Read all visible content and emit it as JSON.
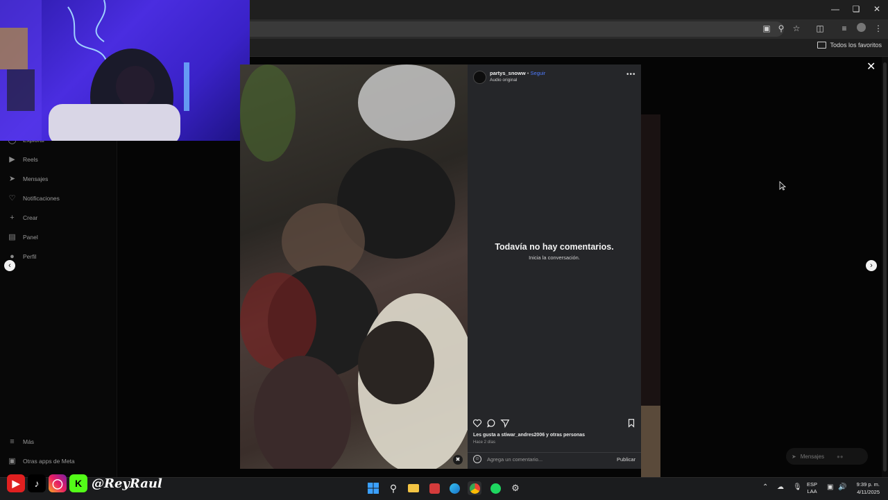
{
  "browser": {
    "bookmarks_folder": "Todos los favoritos"
  },
  "sidebar": {
    "items": [
      {
        "label": "Explorar",
        "icon": "compass-icon"
      },
      {
        "label": "Reels",
        "icon": "reels-icon"
      },
      {
        "label": "Mensajes",
        "icon": "messenger-icon"
      },
      {
        "label": "Notificaciones",
        "icon": "heart-icon"
      },
      {
        "label": "Crear",
        "icon": "plus-icon"
      },
      {
        "label": "Panel",
        "icon": "dashboard-icon"
      },
      {
        "label": "Perfil",
        "icon": "avatar-icon"
      }
    ],
    "bottom": [
      {
        "label": "Más",
        "icon": "menu-icon"
      },
      {
        "label": "Otras apps de Meta",
        "icon": "meta-apps-icon"
      }
    ]
  },
  "post": {
    "username": "partys_snoww",
    "separator": "•",
    "follow_label": "Seguir",
    "audio": "Audio original",
    "empty_title": "Todavía no hay comentarios.",
    "empty_subtitle": "Inicia la conversación.",
    "likes_text": "Les gusta a stiwar_andres2006 y otras personas",
    "time_ago": "Hace 2 días",
    "comment_placeholder": "Agrega un comentario...",
    "publish_label": "Publicar"
  },
  "messages_pill": {
    "label": "Mensajes"
  },
  "overlay": {
    "handle": "@ReyRaul",
    "k_logo": "K"
  },
  "taskbar": {
    "lang_line1": "ESP",
    "lang_line2": "LAA",
    "time": "9:39 p. m.",
    "date": "4/11/2025"
  },
  "colors": {
    "follow_blue": "#4f7cff",
    "panel_bg": "#252629",
    "webcam_light": "#4a2de0"
  }
}
